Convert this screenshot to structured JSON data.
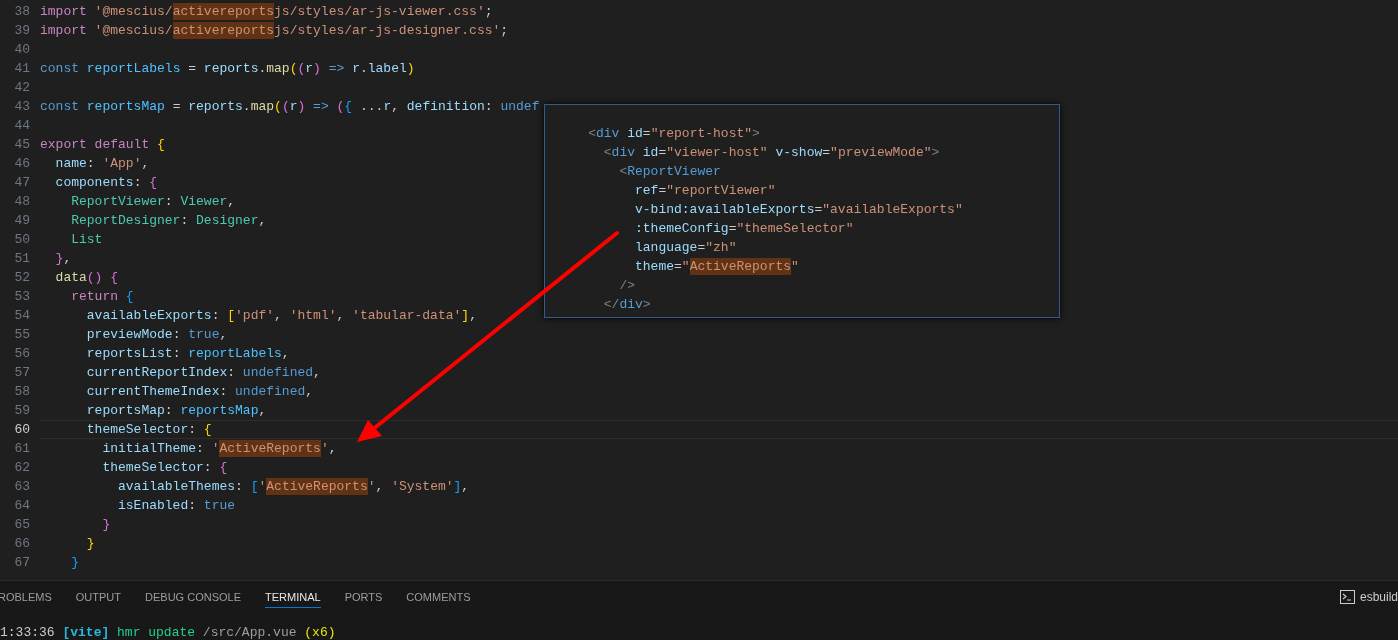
{
  "editor": {
    "lines": [
      {
        "number": "38",
        "current": false,
        "tokens": [
          {
            "text": "import ",
            "kind": "kw"
          },
          {
            "text": "'@mescius/",
            "kind": "str"
          },
          {
            "text": "activereports",
            "kind": "match"
          },
          {
            "text": "js/styles/ar-js-viewer.css'",
            "kind": "str"
          },
          {
            "text": ";",
            "kind": "p"
          }
        ]
      },
      {
        "number": "39",
        "current": false,
        "tokens": [
          {
            "text": "import ",
            "kind": "kw"
          },
          {
            "text": "'@mescius/",
            "kind": "str"
          },
          {
            "text": "activereports",
            "kind": "match"
          },
          {
            "text": "js/styles/ar-js-designer.css'",
            "kind": "str"
          },
          {
            "text": ";",
            "kind": "p"
          }
        ]
      },
      {
        "number": "40",
        "current": false
      },
      {
        "number": "41",
        "current": false,
        "tokens": [
          {
            "text": "const ",
            "kind": "decl"
          },
          {
            "text": "reportLabels",
            "kind": "var"
          },
          {
            "text": " = ",
            "kind": "p"
          },
          {
            "text": "reports",
            "kind": "prop"
          },
          {
            "text": ".",
            "kind": "p"
          },
          {
            "text": "map",
            "kind": "fn"
          },
          {
            "text": "(",
            "kind": "b1"
          },
          {
            "text": "(",
            "kind": "b2"
          },
          {
            "text": "r",
            "kind": "prop"
          },
          {
            "text": ")",
            "kind": "b2"
          },
          {
            "text": " => ",
            "kind": "decl"
          },
          {
            "text": "r",
            "kind": "prop"
          },
          {
            "text": ".",
            "kind": "p"
          },
          {
            "text": "label",
            "kind": "prop"
          },
          {
            "text": ")",
            "kind": "b1"
          }
        ]
      },
      {
        "number": "42",
        "current": false
      },
      {
        "number": "43",
        "current": false,
        "tokens": [
          {
            "text": "const ",
            "kind": "decl"
          },
          {
            "text": "reportsMap",
            "kind": "var"
          },
          {
            "text": " = ",
            "kind": "p"
          },
          {
            "text": "reports",
            "kind": "prop"
          },
          {
            "text": ".",
            "kind": "p"
          },
          {
            "text": "map",
            "kind": "fn"
          },
          {
            "text": "(",
            "kind": "b1"
          },
          {
            "text": "(",
            "kind": "b2"
          },
          {
            "text": "r",
            "kind": "prop"
          },
          {
            "text": ")",
            "kind": "b2"
          },
          {
            "text": " => ",
            "kind": "decl"
          },
          {
            "text": "(",
            "kind": "b2"
          },
          {
            "text": "{",
            "kind": "b3"
          },
          {
            "text": " ...",
            "kind": "p"
          },
          {
            "text": "r",
            "kind": "prop"
          },
          {
            "text": ", ",
            "kind": "p"
          },
          {
            "text": "definition",
            "kind": "prop"
          },
          {
            "text": ": ",
            "kind": "p"
          },
          {
            "text": "undef",
            "kind": "lit"
          }
        ]
      },
      {
        "number": "44",
        "current": false
      },
      {
        "number": "45",
        "current": false,
        "tokens": [
          {
            "text": "export default ",
            "kind": "kw"
          },
          {
            "text": "{",
            "kind": "b1"
          }
        ]
      },
      {
        "number": "46",
        "current": false,
        "tokens": [
          {
            "text": "  name",
            "kind": "prop"
          },
          {
            "text": ": ",
            "kind": "p"
          },
          {
            "text": "'App'",
            "kind": "str"
          },
          {
            "text": ",",
            "kind": "p"
          }
        ]
      },
      {
        "number": "47",
        "current": false,
        "tokens": [
          {
            "text": "  components",
            "kind": "prop"
          },
          {
            "text": ": ",
            "kind": "p"
          },
          {
            "text": "{",
            "kind": "b2"
          }
        ]
      },
      {
        "number": "48",
        "current": false,
        "tokens": [
          {
            "text": "    ReportViewer",
            "kind": "cls"
          },
          {
            "text": ": ",
            "kind": "p"
          },
          {
            "text": "Viewer",
            "kind": "cls"
          },
          {
            "text": ",",
            "kind": "p"
          }
        ]
      },
      {
        "number": "49",
        "current": false,
        "tokens": [
          {
            "text": "    ReportDesigner",
            "kind": "cls"
          },
          {
            "text": ": ",
            "kind": "p"
          },
          {
            "text": "Designer",
            "kind": "cls"
          },
          {
            "text": ",",
            "kind": "p"
          }
        ]
      },
      {
        "number": "50",
        "current": false,
        "tokens": [
          {
            "text": "    List",
            "kind": "cls"
          }
        ]
      },
      {
        "number": "51",
        "current": false,
        "tokens": [
          {
            "text": "  }",
            "kind": "b2"
          },
          {
            "text": ",",
            "kind": "p"
          }
        ]
      },
      {
        "number": "52",
        "current": false,
        "tokens": [
          {
            "text": "  data",
            "kind": "fn"
          },
          {
            "text": "() {",
            "kind": "b2"
          }
        ]
      },
      {
        "number": "53",
        "current": false,
        "tokens": [
          {
            "text": "    return ",
            "kind": "kw"
          },
          {
            "text": "{",
            "kind": "b3"
          }
        ]
      },
      {
        "number": "54",
        "current": false,
        "tokens": [
          {
            "text": "      availableExports",
            "kind": "prop"
          },
          {
            "text": ": ",
            "kind": "p"
          },
          {
            "text": "[",
            "kind": "b1"
          },
          {
            "text": "'pdf'",
            "kind": "str"
          },
          {
            "text": ", ",
            "kind": "p"
          },
          {
            "text": "'html'",
            "kind": "str"
          },
          {
            "text": ", ",
            "kind": "p"
          },
          {
            "text": "'tabular-data'",
            "kind": "str"
          },
          {
            "text": "]",
            "kind": "b1"
          },
          {
            "text": ",",
            "kind": "p"
          }
        ]
      },
      {
        "number": "55",
        "current": false,
        "tokens": [
          {
            "text": "      previewMode",
            "kind": "prop"
          },
          {
            "text": ": ",
            "kind": "p"
          },
          {
            "text": "true",
            "kind": "lit"
          },
          {
            "text": ",",
            "kind": "p"
          }
        ]
      },
      {
        "number": "56",
        "current": false,
        "tokens": [
          {
            "text": "      reportsList",
            "kind": "prop"
          },
          {
            "text": ": ",
            "kind": "p"
          },
          {
            "text": "reportLabels",
            "kind": "var"
          },
          {
            "text": ",",
            "kind": "p"
          }
        ]
      },
      {
        "number": "57",
        "current": false,
        "tokens": [
          {
            "text": "      currentReportIndex",
            "kind": "prop"
          },
          {
            "text": ": ",
            "kind": "p"
          },
          {
            "text": "undefined",
            "kind": "lit"
          },
          {
            "text": ",",
            "kind": "p"
          }
        ]
      },
      {
        "number": "58",
        "current": false,
        "tokens": [
          {
            "text": "      currentThemeIndex",
            "kind": "prop"
          },
          {
            "text": ": ",
            "kind": "p"
          },
          {
            "text": "undefined",
            "kind": "lit"
          },
          {
            "text": ",",
            "kind": "p"
          }
        ]
      },
      {
        "number": "59",
        "current": false,
        "tokens": [
          {
            "text": "      reportsMap",
            "kind": "prop"
          },
          {
            "text": ": ",
            "kind": "p"
          },
          {
            "text": "reportsMap",
            "kind": "var"
          },
          {
            "text": ",",
            "kind": "p"
          }
        ]
      },
      {
        "number": "60",
        "current": true,
        "tokens": [
          {
            "text": "      themeSelector",
            "kind": "prop"
          },
          {
            "text": ": ",
            "kind": "p"
          },
          {
            "text": "{",
            "kind": "b1"
          }
        ]
      },
      {
        "number": "61",
        "current": false,
        "tokens": [
          {
            "text": "        initialTheme",
            "kind": "prop"
          },
          {
            "text": ": ",
            "kind": "p"
          },
          {
            "text": "'",
            "kind": "str"
          },
          {
            "text": "ActiveReports",
            "kind": "match"
          },
          {
            "text": "'",
            "kind": "str"
          },
          {
            "text": ",",
            "kind": "p"
          }
        ]
      },
      {
        "number": "62",
        "current": false,
        "tokens": [
          {
            "text": "        themeSelector",
            "kind": "prop"
          },
          {
            "text": ": ",
            "kind": "p"
          },
          {
            "text": "{",
            "kind": "b2"
          }
        ]
      },
      {
        "number": "63",
        "current": false,
        "tokens": [
          {
            "text": "          availableThemes",
            "kind": "prop"
          },
          {
            "text": ": ",
            "kind": "p"
          },
          {
            "text": "[",
            "kind": "b3"
          },
          {
            "text": "'",
            "kind": "str"
          },
          {
            "text": "ActiveReports",
            "kind": "match"
          },
          {
            "text": "'",
            "kind": "str"
          },
          {
            "text": ", ",
            "kind": "p"
          },
          {
            "text": "'System'",
            "kind": "str"
          },
          {
            "text": "]",
            "kind": "b3"
          },
          {
            "text": ",",
            "kind": "p"
          }
        ]
      },
      {
        "number": "64",
        "current": false,
        "tokens": [
          {
            "text": "          isEnabled",
            "kind": "prop"
          },
          {
            "text": ": ",
            "kind": "p"
          },
          {
            "text": "true",
            "kind": "lit"
          }
        ]
      },
      {
        "number": "65",
        "current": false,
        "tokens": [
          {
            "text": "        }",
            "kind": "b2"
          }
        ]
      },
      {
        "number": "66",
        "current": false,
        "tokens": [
          {
            "text": "      }",
            "kind": "b1"
          }
        ]
      },
      {
        "number": "67",
        "current": false,
        "tokens": [
          {
            "text": "    }",
            "kind": "b3"
          }
        ]
      }
    ]
  },
  "peek": {
    "lines": [
      {
        "tokens": [
          {
            "text": "    <",
            "kind": "punc"
          },
          {
            "text": "div",
            "kind": "tag"
          },
          {
            "text": " id",
            "kind": "attr"
          },
          {
            "text": "=",
            "kind": "p"
          },
          {
            "text": "\"report-host\"",
            "kind": "str"
          },
          {
            "text": ">",
            "kind": "punc"
          }
        ]
      },
      {
        "tokens": [
          {
            "text": "      <",
            "kind": "punc"
          },
          {
            "text": "div",
            "kind": "tag"
          },
          {
            "text": " id",
            "kind": "attr"
          },
          {
            "text": "=",
            "kind": "p"
          },
          {
            "text": "\"viewer-host\"",
            "kind": "str"
          },
          {
            "text": " v-show",
            "kind": "attr"
          },
          {
            "text": "=",
            "kind": "p"
          },
          {
            "text": "\"previewMode\"",
            "kind": "str"
          },
          {
            "text": ">",
            "kind": "punc"
          }
        ]
      },
      {
        "tokens": [
          {
            "text": "        <",
            "kind": "punc"
          },
          {
            "text": "ReportViewer",
            "kind": "tag"
          }
        ]
      },
      {
        "tokens": [
          {
            "text": "          ref",
            "kind": "attr"
          },
          {
            "text": "=",
            "kind": "p"
          },
          {
            "text": "\"reportViewer\"",
            "kind": "str"
          }
        ]
      },
      {
        "tokens": [
          {
            "text": "          v-bind:availableExports",
            "kind": "attr"
          },
          {
            "text": "=",
            "kind": "p"
          },
          {
            "text": "\"availableExports\"",
            "kind": "str"
          }
        ]
      },
      {
        "tokens": [
          {
            "text": "          :themeConfig",
            "kind": "attr"
          },
          {
            "text": "=",
            "kind": "p"
          },
          {
            "text": "\"themeSelector\"",
            "kind": "str"
          }
        ]
      },
      {
        "tokens": [
          {
            "text": "          language",
            "kind": "attr"
          },
          {
            "text": "=",
            "kind": "p"
          },
          {
            "text": "\"zh\"",
            "kind": "str"
          }
        ]
      },
      {
        "tokens": [
          {
            "text": "          theme",
            "kind": "attr"
          },
          {
            "text": "=",
            "kind": "p"
          },
          {
            "text": "\"",
            "kind": "str"
          },
          {
            "text": "ActiveReports",
            "kind": "match"
          },
          {
            "text": "\"",
            "kind": "str"
          }
        ]
      },
      {
        "tokens": [
          {
            "text": "        />",
            "kind": "punc"
          }
        ]
      },
      {
        "tokens": [
          {
            "text": "      </",
            "kind": "punc"
          },
          {
            "text": "div",
            "kind": "tag"
          },
          {
            "text": ">",
            "kind": "punc"
          }
        ]
      }
    ]
  },
  "panel": {
    "tabs": [
      {
        "label": "ROBLEMS",
        "selected": false
      },
      {
        "label": "OUTPUT",
        "selected": false
      },
      {
        "label": "DEBUG CONSOLE",
        "selected": false
      },
      {
        "label": "TERMINAL",
        "selected": true
      },
      {
        "label": "PORTS",
        "selected": false
      },
      {
        "label": "COMMENTS",
        "selected": false
      }
    ],
    "terminal_button": "esbuild",
    "terminal_line": [
      {
        "text": "1:33:36 ",
        "kind": "time"
      },
      {
        "text": "[vite]",
        "kind": "tool"
      },
      {
        "text": " hmr update",
        "kind": "ok"
      },
      {
        "text": " /src/App.vue",
        "kind": "path"
      },
      {
        "text": " (x6)",
        "kind": "count"
      }
    ]
  }
}
